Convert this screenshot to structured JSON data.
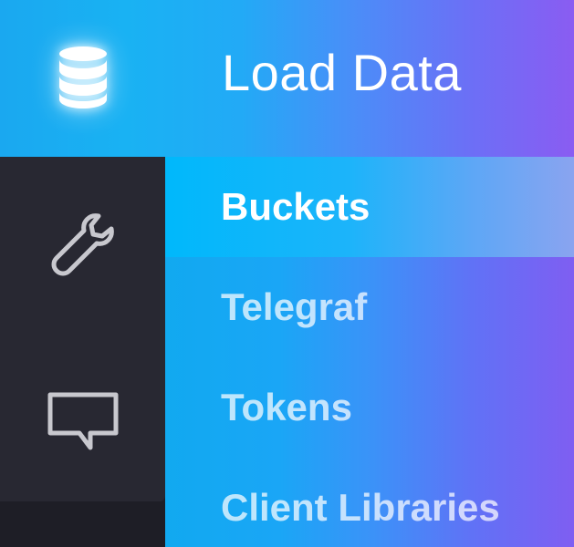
{
  "header": {
    "title": "Load Data",
    "icon": "database-icon"
  },
  "rail": {
    "items": [
      {
        "icon": "wrench-icon"
      },
      {
        "icon": "chat-bubble-icon"
      }
    ]
  },
  "submenu": {
    "items": [
      {
        "label": "Buckets",
        "active": true
      },
      {
        "label": "Telegraf",
        "active": false
      },
      {
        "label": "Tokens",
        "active": false
      },
      {
        "label": "Client Libraries",
        "active": false
      }
    ]
  },
  "colors": {
    "rail_background": "#282832",
    "header_gradient_start": "#1aa8f0",
    "header_gradient_end": "#8a5cf2",
    "active_item_highlight": "#00b8fb",
    "text": "#ffffff"
  }
}
